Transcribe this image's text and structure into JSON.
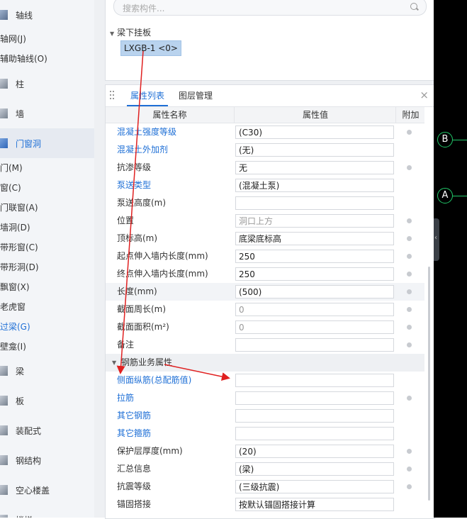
{
  "nav": {
    "categories": [
      {
        "key": "axis",
        "label": "轴线"
      },
      {
        "key": "column",
        "label": "柱"
      },
      {
        "key": "wall",
        "label": "墙"
      },
      {
        "key": "door_window",
        "label": "门窗洞"
      },
      {
        "key": "beam",
        "label": "梁"
      },
      {
        "key": "slab",
        "label": "板"
      },
      {
        "key": "prefab",
        "label": "装配式"
      },
      {
        "key": "steel",
        "label": "钢结构"
      },
      {
        "key": "hollow_floor",
        "label": "空心楼盖"
      }
    ],
    "axis_items": [
      "轴网(J)",
      "辅助轴线(O)"
    ],
    "door_items": [
      "门(M)",
      "窗(C)",
      "门联窗(A)",
      "墙洞(D)",
      "带形窗(C)",
      "带形洞(D)",
      "飘窗(X)",
      "老虎窗",
      "过梁(G)",
      "壁龛(I)"
    ],
    "selected_item": "过梁(G)",
    "bottom_partial": "楼梯"
  },
  "search": {
    "placeholder": "搜索构件..."
  },
  "tree": {
    "root": "梁下挂板",
    "leaf": "LXGB-1 <0>"
  },
  "tabs": {
    "properties": "属性列表",
    "layers": "图层管理",
    "close": "×"
  },
  "table": {
    "headers": {
      "name": "属性名称",
      "value": "属性值",
      "extra": "附加"
    },
    "rows": [
      {
        "name": "混凝土强度等级",
        "value": "(C30)",
        "blue": true,
        "readonly": false,
        "check": true
      },
      {
        "name": "混凝土外加剂",
        "value": "(无)",
        "blue": true,
        "readonly": false,
        "check": false
      },
      {
        "name": "抗渗等级",
        "value": "无",
        "blue": false,
        "readonly": false,
        "check": true
      },
      {
        "name": "泵送类型",
        "value": "(混凝土泵)",
        "blue": true,
        "readonly": false,
        "check": false
      },
      {
        "name": "泵送高度(m)",
        "value": "",
        "blue": false,
        "readonly": false,
        "check": false
      },
      {
        "name": "位置",
        "value": "洞口上方",
        "blue": false,
        "readonly": true,
        "check": true
      },
      {
        "name": "顶标高(m)",
        "value": "底梁底标高",
        "blue": false,
        "readonly": false,
        "check": true
      },
      {
        "name": "起点伸入墙内长度(mm)",
        "value": "250",
        "blue": false,
        "readonly": false,
        "check": true
      },
      {
        "name": "终点伸入墙内长度(mm)",
        "value": "250",
        "blue": false,
        "readonly": false,
        "check": true
      },
      {
        "name": "长度(mm)",
        "value": "(500)",
        "blue": false,
        "readonly": false,
        "check": true,
        "highlight": true
      },
      {
        "name": "截面周长(m)",
        "value": "0",
        "blue": false,
        "readonly": true,
        "check": true
      },
      {
        "name": "截面面积(m²)",
        "value": "0",
        "blue": false,
        "readonly": true,
        "check": true
      },
      {
        "name": "备注",
        "value": "",
        "blue": false,
        "readonly": false,
        "check": true
      }
    ],
    "group": "钢筋业务属性",
    "rebar_rows": [
      {
        "name": "侧面纵筋(总配筋值)",
        "value": "",
        "blue": true,
        "readonly": false,
        "check": false
      },
      {
        "name": "拉筋",
        "value": "",
        "blue": true,
        "readonly": false,
        "check": true
      },
      {
        "name": "其它钢筋",
        "value": "",
        "blue": true,
        "readonly": false,
        "check": false
      },
      {
        "name": "其它箍筋",
        "value": "",
        "blue": true,
        "readonly": false,
        "check": false
      },
      {
        "name": "保护层厚度(mm)",
        "value": "(20)",
        "blue": false,
        "readonly": false,
        "check": true
      },
      {
        "name": "汇总信息",
        "value": "(梁)",
        "blue": false,
        "readonly": false,
        "check": true
      },
      {
        "name": "抗震等级",
        "value": "(三级抗震)",
        "blue": false,
        "readonly": false,
        "check": true
      },
      {
        "name": "锚固搭接",
        "value": "按默认锚固搭接计算",
        "blue": false,
        "readonly": false,
        "check": false
      }
    ]
  },
  "canvas": {
    "axis_labels": [
      "B",
      "A"
    ]
  },
  "colors": {
    "accent": "#1e6fd6",
    "axis_green": "#22c96a",
    "arrow_red": "#e02020"
  }
}
